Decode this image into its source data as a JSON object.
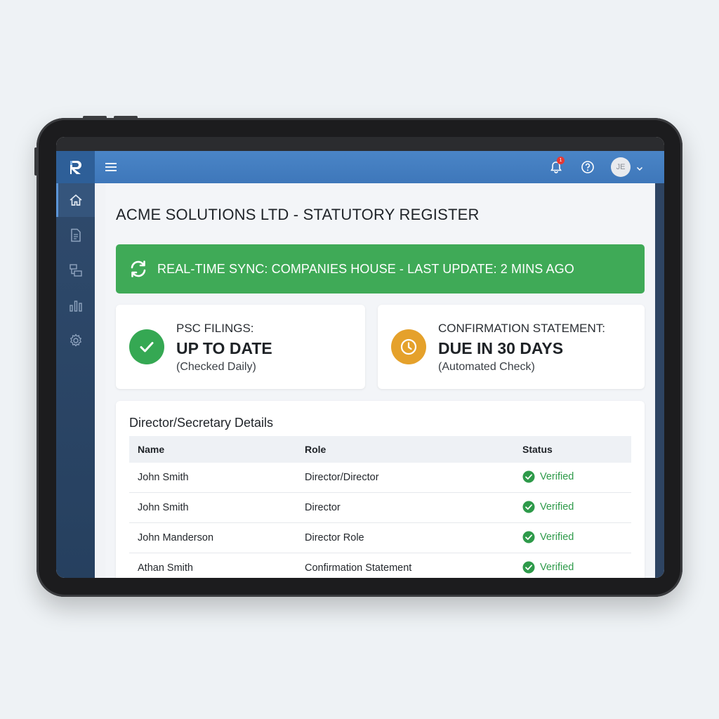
{
  "app": {
    "logo_letter": "R",
    "page_title": "ACME SOLUTIONS LTD - STATUTORY REGISTER"
  },
  "header": {
    "notification_count": "1",
    "avatar_initials": "JE",
    "icons": [
      "menu-icon",
      "bell-icon",
      "help-icon",
      "chevron-down-icon"
    ]
  },
  "sidebar": {
    "items": [
      {
        "icon": "home-icon",
        "active": true
      },
      {
        "icon": "document-icon",
        "active": false
      },
      {
        "icon": "registers-icon",
        "active": false
      },
      {
        "icon": "bar-chart-icon",
        "active": false
      },
      {
        "icon": "gear-icon",
        "active": false
      }
    ]
  },
  "sync_banner": {
    "text": "REAL-TIME SYNC: COMPANIES HOUSE - LAST UPDATE: 2 MINS AGO",
    "icon": "sync-icon",
    "color": "#3faa57"
  },
  "cards": [
    {
      "label": "PSC FILINGS:",
      "value": "UP TO DATE",
      "note": "(Checked Daily)",
      "icon": "check-icon",
      "color": "#35a853"
    },
    {
      "label": "CONFIRMATION STATEMENT:",
      "value": "DUE IN 30 DAYS",
      "note": "(Automated Check)",
      "icon": "clock-icon",
      "color": "#e5a12b"
    }
  ],
  "table": {
    "title": "Director/Secretary Details",
    "headers": [
      "Name",
      "Role",
      "Status"
    ],
    "rows": [
      {
        "name": "John Smith",
        "role": "Director/Director",
        "status": "Verified"
      },
      {
        "name": "John Smith",
        "role": "Director",
        "status": "Verified"
      },
      {
        "name": "John Manderson",
        "role": "Director Role",
        "status": "Verified"
      },
      {
        "name": "Athan Smith",
        "role": "Confirmation Statement",
        "status": "Verified"
      }
    ],
    "status_color": "#2e9a4a"
  }
}
